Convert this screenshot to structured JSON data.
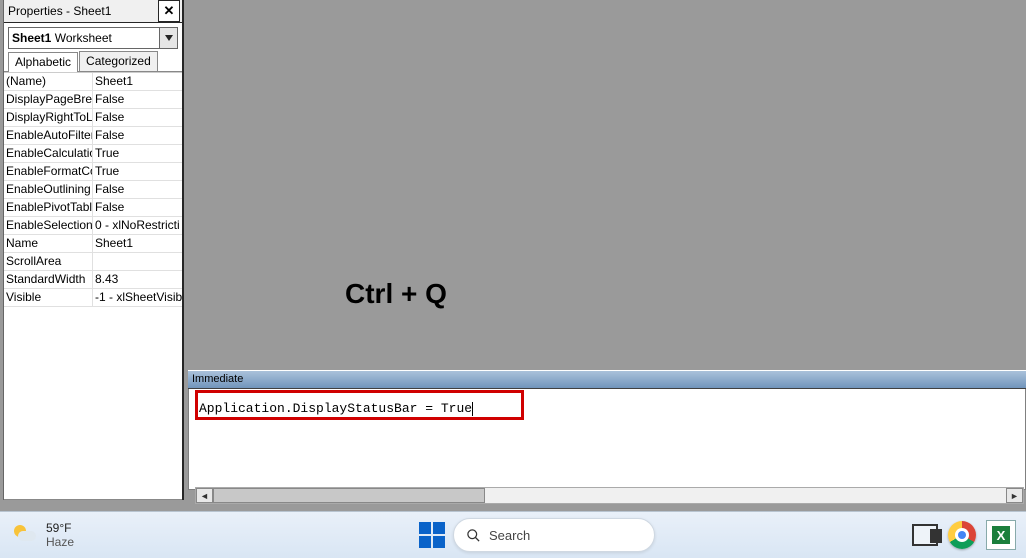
{
  "properties": {
    "title": "Properties - Sheet1",
    "object": {
      "name": "Sheet1",
      "type": "Worksheet"
    },
    "tabs": {
      "alphabetic": "Alphabetic",
      "categorized": "Categorized"
    },
    "rows": [
      {
        "k": "(Name)",
        "v": "Sheet1"
      },
      {
        "k": "DisplayPageBreaks",
        "v": "False"
      },
      {
        "k": "DisplayRightToLeft",
        "v": "False"
      },
      {
        "k": "EnableAutoFilter",
        "v": "False"
      },
      {
        "k": "EnableCalculation",
        "v": "True"
      },
      {
        "k": "EnableFormatCondi",
        "v": "True"
      },
      {
        "k": "EnableOutlining",
        "v": "False"
      },
      {
        "k": "EnablePivotTable",
        "v": "False"
      },
      {
        "k": "EnableSelection",
        "v": "0 - xlNoRestricti"
      },
      {
        "k": "Name",
        "v": "Sheet1"
      },
      {
        "k": "ScrollArea",
        "v": ""
      },
      {
        "k": "StandardWidth",
        "v": "8.43"
      },
      {
        "k": "Visible",
        "v": "-1 - xlSheetVisib"
      }
    ]
  },
  "overlay": {
    "text": "Ctrl + Q"
  },
  "immediate": {
    "title": "Immediate",
    "code": "Application.DisplayStatusBar = True"
  },
  "taskbar": {
    "weather": {
      "temp": "59°F",
      "desc": "Haze"
    },
    "search": {
      "placeholder": "Search"
    },
    "excel_letter": "X"
  }
}
